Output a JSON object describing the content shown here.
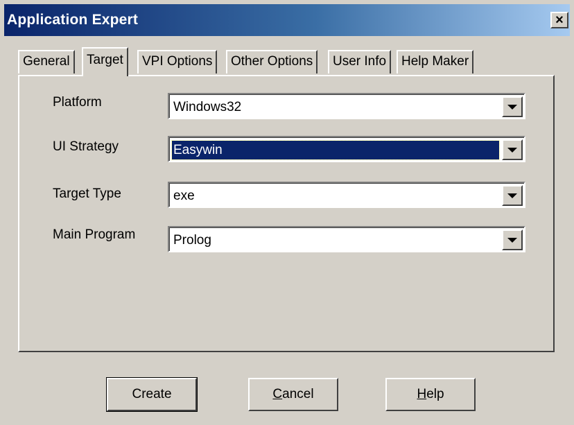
{
  "window": {
    "title": "Application Expert",
    "close_label": "×"
  },
  "tabs": [
    {
      "label": "General",
      "active": false
    },
    {
      "label": "Target",
      "active": true
    },
    {
      "label": "VPI Options",
      "active": false
    },
    {
      "label": "Other Options",
      "active": false
    },
    {
      "label": "User Info",
      "active": false
    },
    {
      "label": "Help Maker",
      "active": false
    }
  ],
  "fields": {
    "platform": {
      "label": "Platform",
      "value": "Windows32"
    },
    "ui_strategy": {
      "label": "UI Strategy",
      "value": "Easywin"
    },
    "target_type": {
      "label": "Target Type",
      "value": "exe"
    },
    "main_program": {
      "label": "Main Program",
      "value": "Prolog"
    }
  },
  "buttons": {
    "create": {
      "label": "Create"
    },
    "cancel": {
      "mnemonic": "C",
      "rest": "ancel"
    },
    "help": {
      "mnemonic": "H",
      "rest": "elp"
    }
  },
  "colors": {
    "face": "#d4d0c8",
    "title_start": "#0a246a",
    "title_end": "#a6caf0",
    "selection": "#0a246a"
  }
}
